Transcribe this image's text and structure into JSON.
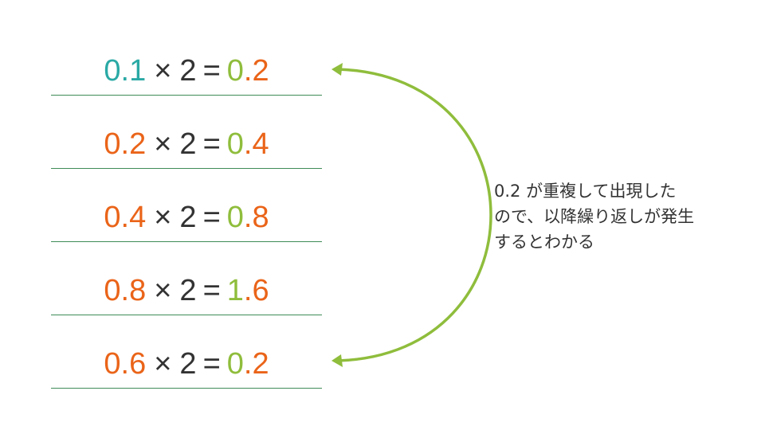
{
  "rows": [
    {
      "input": "0.1",
      "input_color": "teal",
      "times": "×",
      "factor": "2",
      "equals": "=",
      "result_int": "0",
      "result_frac": ".2"
    },
    {
      "input": "0.2",
      "input_color": "orange",
      "times": "×",
      "factor": "2",
      "equals": "=",
      "result_int": "0",
      "result_frac": ".4"
    },
    {
      "input": "0.4",
      "input_color": "orange",
      "times": "×",
      "factor": "2",
      "equals": "=",
      "result_int": "0",
      "result_frac": ".8"
    },
    {
      "input": "0.8",
      "input_color": "orange",
      "times": "×",
      "factor": "2",
      "equals": "=",
      "result_int": "1",
      "result_frac": ".6"
    },
    {
      "input": "0.6",
      "input_color": "orange",
      "times": "×",
      "factor": "2",
      "equals": "=",
      "result_int": "0",
      "result_frac": ".2"
    }
  ],
  "note": {
    "line1": "0.2 が重複して出現した",
    "line2": "ので、以降繰り返しが発生",
    "line3": "するとわかる"
  },
  "colors": {
    "teal": "#2aa9a5",
    "orange": "#ea6419",
    "green": "#8fbd3c",
    "text": "#333333",
    "rule": "#3e8c57"
  }
}
